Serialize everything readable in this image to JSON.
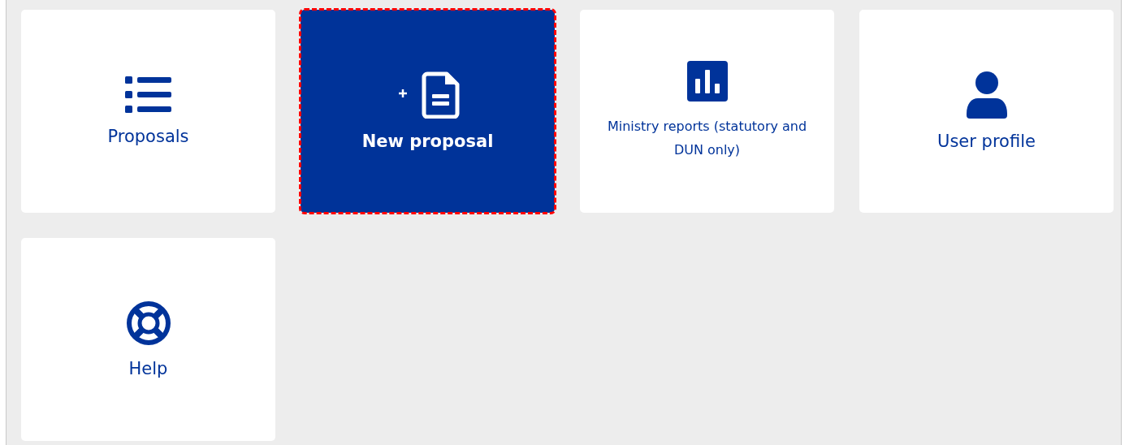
{
  "tiles": [
    {
      "label": "Proposals",
      "kind": "large",
      "focused": false
    },
    {
      "label": "New proposal",
      "kind": "large",
      "focused": true
    },
    {
      "label": "Ministry reports (statutory and DUN only)",
      "kind": "small",
      "focused": false
    },
    {
      "label": "User profile",
      "kind": "large",
      "focused": false
    },
    {
      "label": "Help",
      "kind": "large",
      "focused": false
    }
  ]
}
